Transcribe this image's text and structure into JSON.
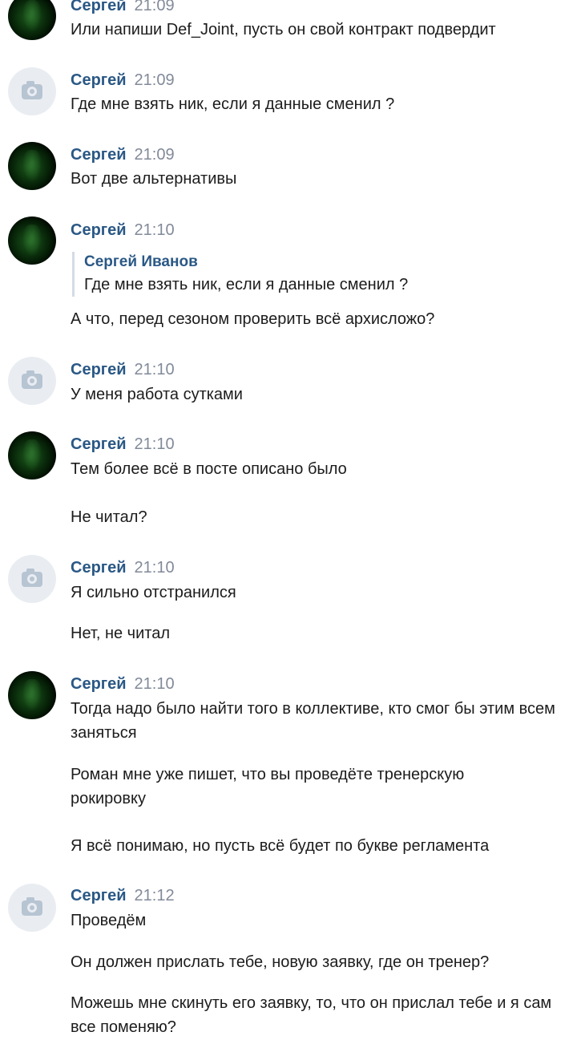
{
  "messages": [
    {
      "author": "Сергей",
      "time": "21:09",
      "avatar": "dark-green-photo",
      "texts": [
        "Или напиши Def_Joint, пусть он свой контракт подвердит"
      ]
    },
    {
      "author": "Сергей",
      "time": "21:09",
      "avatar": "camera-placeholder",
      "texts": [
        "Где мне взять ник, если я данные сменил ?"
      ]
    },
    {
      "author": "Сергей",
      "time": "21:09",
      "avatar": "dark-green-photo",
      "texts": [
        "Вот две альтернативы"
      ]
    },
    {
      "author": "Сергей",
      "time": "21:10",
      "avatar": "dark-green-photo",
      "quote": {
        "author": "Сергей Иванов",
        "text": "Где мне взять ник, если я данные сменил ?"
      },
      "texts": [
        "А что, перед сезоном проверить всё архисложо?"
      ]
    },
    {
      "author": "Сергей",
      "time": "21:10",
      "avatar": "camera-placeholder",
      "texts": [
        "У меня работа сутками"
      ]
    },
    {
      "author": "Сергей",
      "time": "21:10",
      "avatar": "dark-green-photo",
      "texts": [
        "Тем более всё в посте описано было",
        "Не читал?"
      ]
    },
    {
      "author": "Сергей",
      "time": "21:10",
      "avatar": "camera-placeholder",
      "texts": [
        "Я сильно отстранился",
        "Нет, не читал"
      ]
    },
    {
      "author": "Сергей",
      "time": "21:10",
      "avatar": "dark-green-photo",
      "texts": [
        "Тогда надо было найти того в коллективе, кто смог бы этим всем заняться",
        "Роман мне уже пишет, что вы проведёте тренерскую рокировку",
        "Я всё понимаю, но пусть всё будет по букве регламента"
      ]
    },
    {
      "author": "Сергей",
      "time": "21:12",
      "avatar": "camera-placeholder",
      "texts": [
        "Проведём",
        "Он должен прислать тебе, новую заявку, где он тренер?",
        "Можешь мне скинуть его заявку, то, что он прислал тебе и я сам все поменяю?"
      ]
    }
  ]
}
